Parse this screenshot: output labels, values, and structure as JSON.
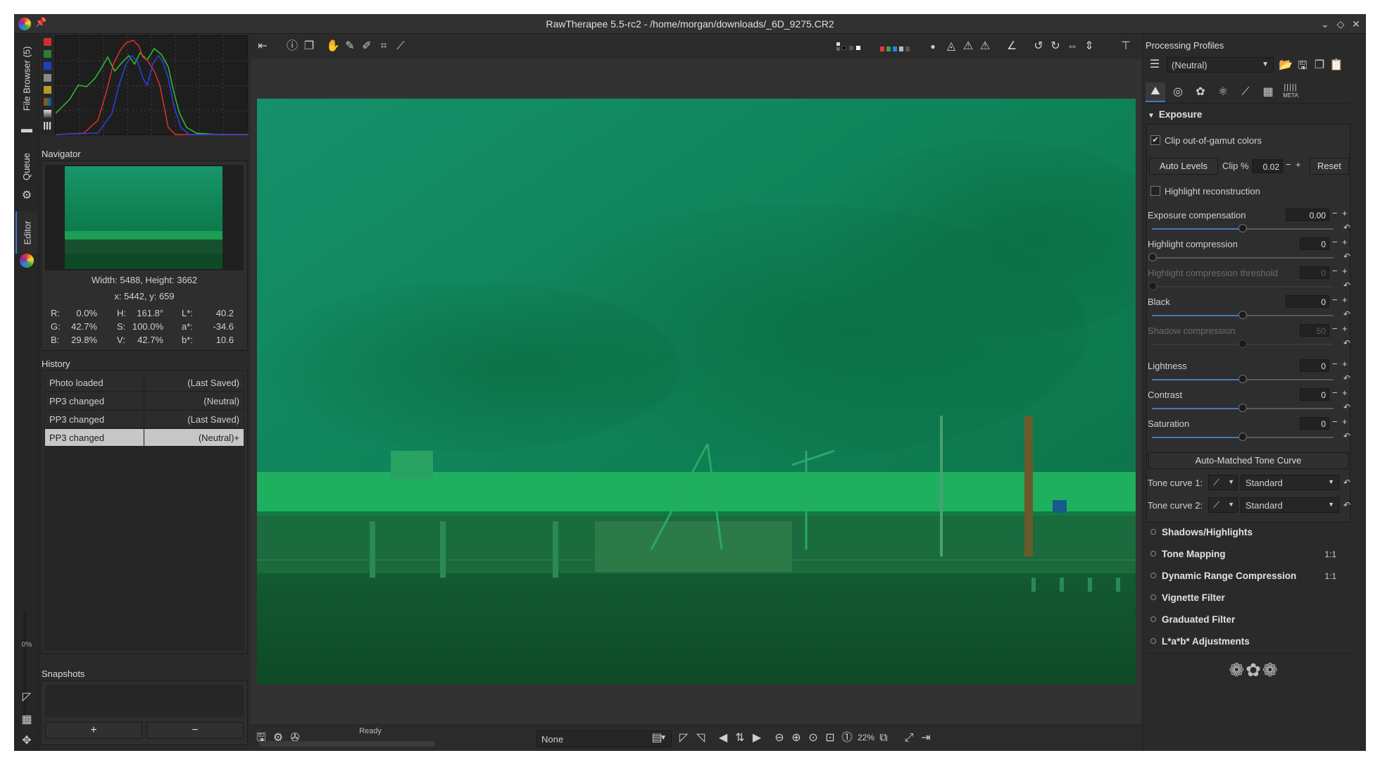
{
  "window": {
    "title": "RawTherapee 5.5-rc2 - /home/morgan/downloads/_6D_9275.CR2"
  },
  "left_strip": {
    "tabs": [
      "File Browser (5)",
      "Queue",
      "Editor"
    ],
    "zoom_percent": "0%"
  },
  "navigator": {
    "title": "Navigator",
    "dimensions": "Width: 5488, Height: 3662",
    "coords": "x: 5442, y: 659",
    "readout": {
      "r_label": "R:",
      "r_value": "0.0%",
      "g_label": "G:",
      "g_value": "42.7%",
      "b_label": "B:",
      "b_value": "29.8%",
      "h_label": "H:",
      "h_value": "161.8°",
      "s_label": "S:",
      "s_value": "100.0%",
      "v_label": "V:",
      "v_value": "42.7%",
      "l_label": "L*:",
      "l_value": "40.2",
      "a_label": "a*:",
      "a_value": "-34.6",
      "bb_label": "b*:",
      "bb_value": "10.6"
    }
  },
  "history": {
    "title": "History",
    "rows": [
      {
        "action": "Photo loaded",
        "profile": "(Last Saved)"
      },
      {
        "action": "PP3 changed",
        "profile": "(Neutral)"
      },
      {
        "action": "PP3 changed",
        "profile": "(Last Saved)"
      },
      {
        "action": "PP3 changed",
        "profile": "(Neutral)+"
      }
    ]
  },
  "snapshots": {
    "title": "Snapshots",
    "add_label": "+",
    "remove_label": "−"
  },
  "status": {
    "ready": "Ready",
    "preview_mode": "None",
    "zoom": "22%"
  },
  "right": {
    "profiles_title": "Processing Profiles",
    "profile_value": "(Neutral)",
    "exposure": {
      "title": "Exposure",
      "clip_label": "Clip out-of-gamut colors",
      "auto_levels": "Auto Levels",
      "clip_pct_label": "Clip %",
      "clip_pct_value": "0.02",
      "reset": "Reset",
      "highlight_recon": "Highlight reconstruction",
      "exp_comp_label": "Exposure compensation",
      "exp_comp_value": "0.00",
      "hl_comp_label": "Highlight compression",
      "hl_comp_value": "0",
      "hl_thresh_label": "Highlight compression threshold",
      "hl_thresh_value": "0",
      "black_label": "Black",
      "black_value": "0",
      "shadow_comp_label": "Shadow compression",
      "shadow_comp_value": "50",
      "lightness_label": "Lightness",
      "lightness_value": "0",
      "contrast_label": "Contrast",
      "contrast_value": "0",
      "saturation_label": "Saturation",
      "saturation_value": "0",
      "auto_matched": "Auto-Matched Tone Curve",
      "tone1_label": "Tone curve 1:",
      "tone1_value": "Standard",
      "tone2_label": "Tone curve 2:",
      "tone2_value": "Standard"
    },
    "collapsed": [
      {
        "label": "Shadows/Highlights",
        "badge": ""
      },
      {
        "label": "Tone Mapping",
        "badge": "1:1"
      },
      {
        "label": "Dynamic Range Compression",
        "badge": "1:1"
      },
      {
        "label": "Vignette Filter",
        "badge": ""
      },
      {
        "label": "Graduated Filter",
        "badge": ""
      },
      {
        "label": "L*a*b* Adjustments",
        "badge": ""
      }
    ],
    "meta_tab": "META"
  },
  "colors": {
    "image_green": "#13894f",
    "panel_bg": "#2a2a2a",
    "selection": "#c7c7c7",
    "slider_fill": "#4a78b8"
  }
}
